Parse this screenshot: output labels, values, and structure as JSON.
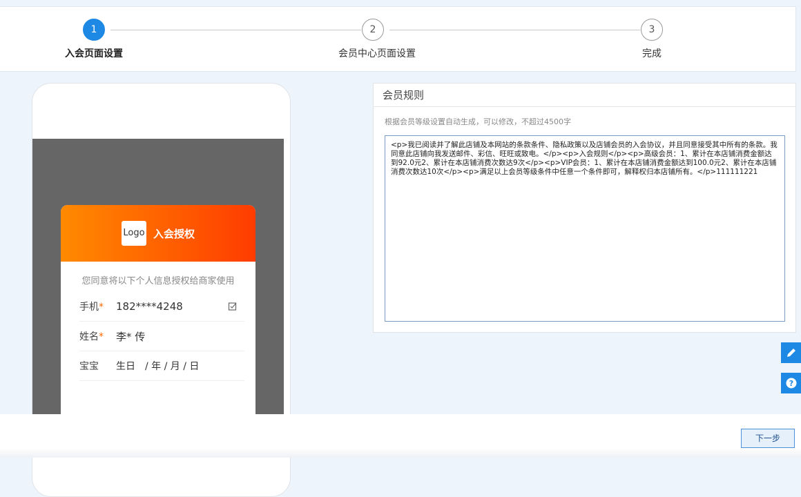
{
  "steps": [
    {
      "number": "1",
      "label": "入会页面设置"
    },
    {
      "number": "2",
      "label": "会员中心页面设置"
    },
    {
      "number": "3",
      "label": "完成"
    }
  ],
  "preview": {
    "logo": "Logo",
    "title": "入会授权",
    "description": "您同意将以下个人信息授权给商家使用",
    "fields": [
      {
        "label": "手机",
        "required": "*",
        "value": "182****4248"
      },
      {
        "label": "姓名",
        "required": "*",
        "value": "李* 传"
      },
      {
        "label": "宝宝",
        "required": "",
        "value": "生日　/ 年 / 月 / 日"
      }
    ]
  },
  "rules": {
    "title": "会员规则",
    "hint": "根据会员等级设置自动生成，可以修改，不超过4500字",
    "content": "<p>我已阅读并了解此店铺及本网站的条款条件、隐私政策以及店铺会员的入会协议，并且同意接受其中所有的条款。我同意此店铺向我发送邮件、彩信、旺旺或致电。</p><p>入会规则</p><p>高级会员：1、累计在本店铺消费金额达到92.0元2、累计在本店铺消费次数达9次</p><p>VIP会员：1、累计在本店铺消费金额达到100.0元2、累计在本店铺消费次数达10次</p><p>满足以上会员等级条件中任意一个条件即可，解释权归本店铺所有。</p>111111221"
  },
  "footer": {
    "next_label": "下一步"
  },
  "colors": {
    "primary": "#1e88e5",
    "header_gradient_start": "#ff8a00",
    "header_gradient_end": "#ff3c00"
  }
}
